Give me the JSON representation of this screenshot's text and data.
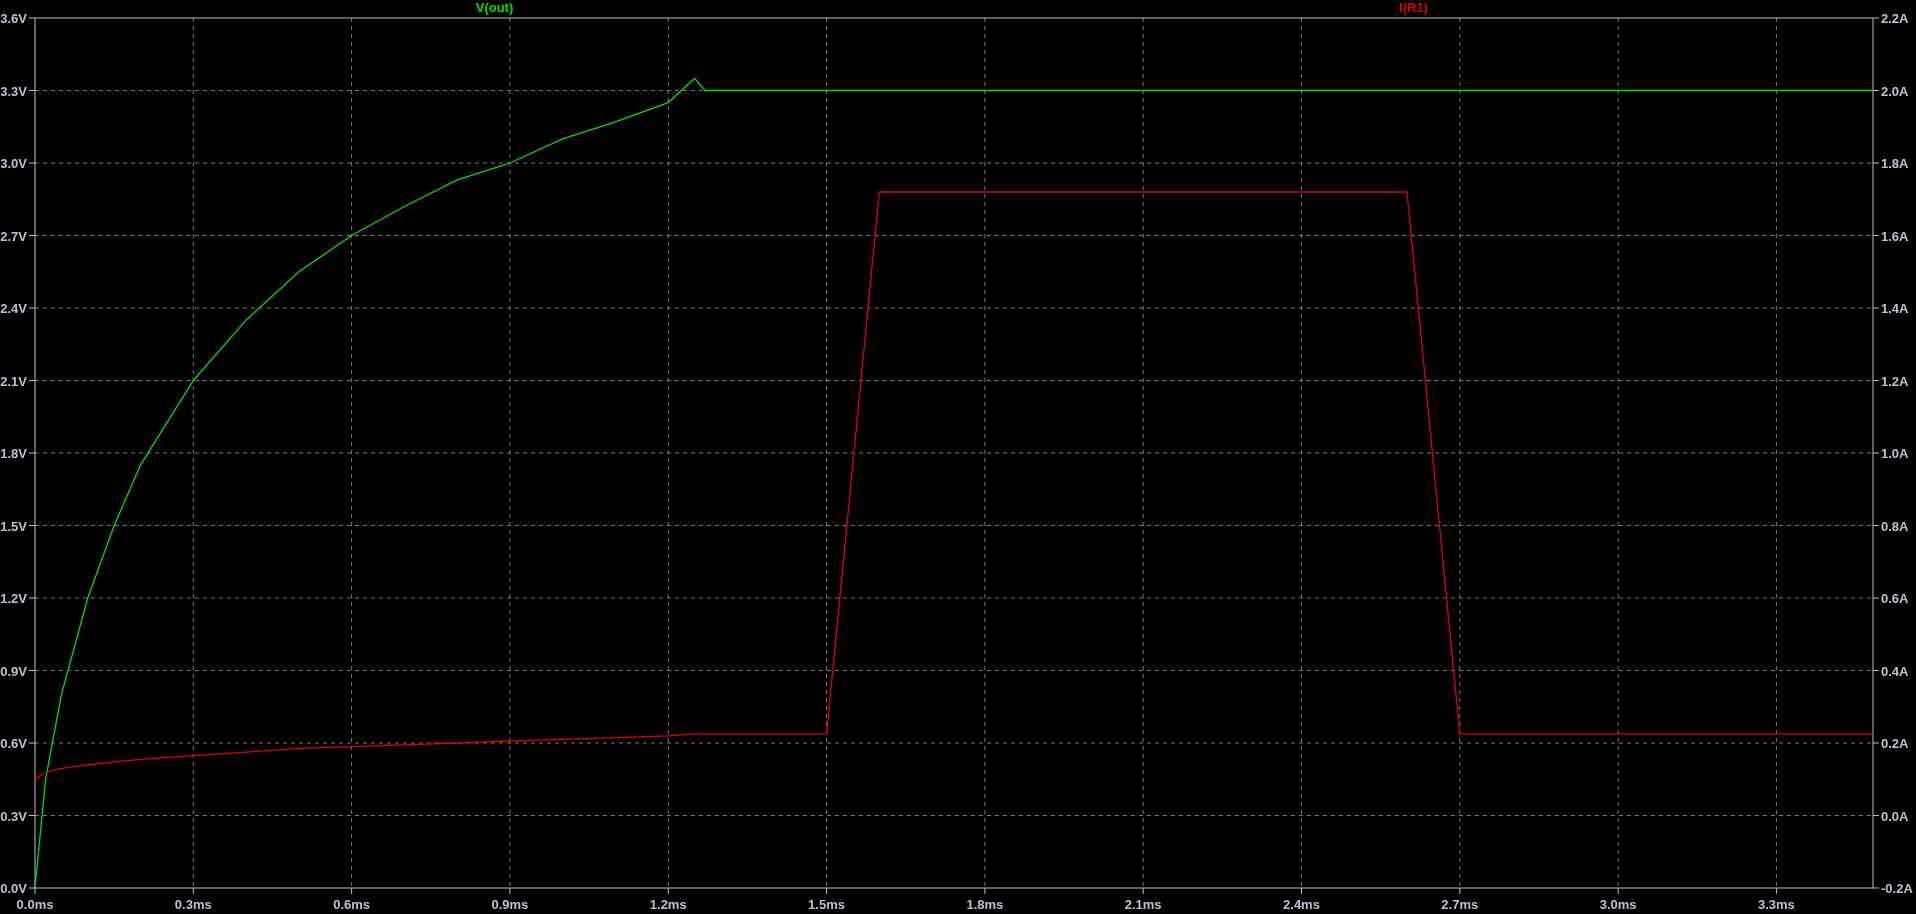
{
  "chart_data": {
    "type": "line",
    "grid": true,
    "x": [
      0,
      0.02,
      0.05,
      0.1,
      0.15,
      0.2,
      0.3,
      0.4,
      0.5,
      0.6,
      0.7,
      0.8,
      0.9,
      1.0,
      1.1,
      1.2,
      1.25,
      1.27,
      1.5,
      1.6,
      2.6,
      2.7,
      3.0,
      3.483
    ],
    "series": [
      {
        "name": "V(out)",
        "color": "#00e000",
        "axis": "y",
        "values": [
          0,
          0.45,
          0.8,
          1.2,
          1.5,
          1.75,
          2.1,
          2.35,
          2.55,
          2.7,
          2.82,
          2.93,
          3.0,
          3.1,
          3.17,
          3.25,
          3.35,
          3.3,
          3.3,
          3.3,
          3.3,
          3.3,
          3.3,
          3.3
        ]
      },
      {
        "name": "I(R1)",
        "color": "#e00000",
        "axis": "y2",
        "values": [
          0.1,
          0.12,
          0.13,
          0.14,
          0.148,
          0.155,
          0.165,
          0.175,
          0.185,
          0.19,
          0.195,
          0.2,
          0.205,
          0.21,
          0.215,
          0.22,
          0.225,
          0.225,
          0.225,
          1.72,
          1.72,
          0.225,
          0.225,
          0.225
        ]
      }
    ],
    "xlim": [
      0,
      3.483
    ],
    "xticks": [
      {
        "value": 0,
        "label": "0.0ms"
      },
      {
        "value": 0.3,
        "label": "0.3ms"
      },
      {
        "value": 0.6,
        "label": "0.6ms"
      },
      {
        "value": 0.9,
        "label": "0.9ms"
      },
      {
        "value": 1.2,
        "label": "1.2ms"
      },
      {
        "value": 1.5,
        "label": "1.5ms"
      },
      {
        "value": 1.8,
        "label": "1.8ms"
      },
      {
        "value": 2.1,
        "label": "2.1ms"
      },
      {
        "value": 2.4,
        "label": "2.4ms"
      },
      {
        "value": 2.7,
        "label": "2.7ms"
      },
      {
        "value": 3.0,
        "label": "3.0ms"
      },
      {
        "value": 3.3,
        "label": "3.3ms"
      }
    ],
    "ylim": [
      0,
      3.6
    ],
    "yticks": [
      {
        "value": 0,
        "label": "0.0V"
      },
      {
        "value": 0.3,
        "label": "0.3V"
      },
      {
        "value": 0.6,
        "label": "0.6V"
      },
      {
        "value": 0.9,
        "label": "0.9V"
      },
      {
        "value": 1.2,
        "label": "1.2V"
      },
      {
        "value": 1.5,
        "label": "1.5V"
      },
      {
        "value": 1.8,
        "label": "1.8V"
      },
      {
        "value": 2.1,
        "label": "2.1V"
      },
      {
        "value": 2.4,
        "label": "2.4V"
      },
      {
        "value": 2.7,
        "label": "2.7V"
      },
      {
        "value": 3.0,
        "label": "3.0V"
      },
      {
        "value": 3.3,
        "label": "3.3V"
      },
      {
        "value": 3.6,
        "label": "3.6V"
      }
    ],
    "y2lim": [
      -0.2,
      2.2
    ],
    "y2ticks": [
      {
        "value": -0.2,
        "label": "-0.2A"
      },
      {
        "value": 0,
        "label": "0.0A"
      },
      {
        "value": 0.2,
        "label": "0.2A"
      },
      {
        "value": 0.4,
        "label": "0.4A"
      },
      {
        "value": 0.6,
        "label": "0.6A"
      },
      {
        "value": 0.8,
        "label": "0.8A"
      },
      {
        "value": 1.0,
        "label": "1.0A"
      },
      {
        "value": 1.2,
        "label": "1.2A"
      },
      {
        "value": 1.4,
        "label": "1.4A"
      },
      {
        "value": 1.6,
        "label": "1.6A"
      },
      {
        "value": 1.8,
        "label": "1.8A"
      },
      {
        "value": 2.0,
        "label": "2.0A"
      },
      {
        "value": 2.2,
        "label": "2.2A"
      }
    ]
  }
}
